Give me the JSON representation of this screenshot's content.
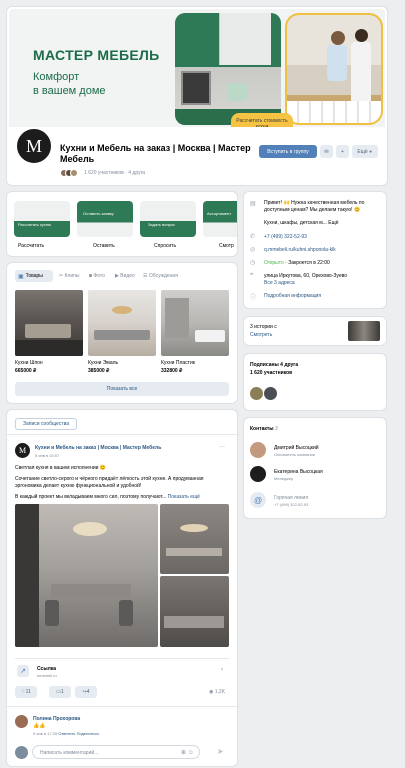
{
  "cover": {
    "brand": "МАСТЕР МЕБЕЛЬ",
    "tagline1": "Комфорт",
    "tagline2": "в вашем доме",
    "cta": "Рассчитать стоимость кухни",
    "brand_color": "#1d6b4a"
  },
  "group": {
    "name": "Кухни и Мебель на заказ | Москва | Мастер",
    "name2": "Мебель",
    "members_line": "1 620 участников · 4 друга",
    "join_button": "Вступить в группу",
    "more_button": "Ещё"
  },
  "services": [
    {
      "thumb": "Рассчитать кухню",
      "label": "Рассчитать"
    },
    {
      "thumb": "Оставить заявку",
      "label": "Оставить"
    },
    {
      "thumb": "Задать вопрос",
      "label": "Спросить"
    },
    {
      "thumb": "Ассортимент",
      "label": "Смотр"
    }
  ],
  "tabs": {
    "goods": "Товары",
    "clips": "Клипы",
    "photo": "Фото",
    "video": "Видео",
    "discussions": "Обсуждения"
  },
  "products": [
    {
      "name": "Кухни Шпон",
      "price": "665000 ₽"
    },
    {
      "name": "Кухни Эмаль",
      "price": "385000 ₽"
    },
    {
      "name": "Кухни Пластик",
      "price": "332800 ₽"
    }
  ],
  "show_all": "Показать все",
  "feed": {
    "tab": "Записи сообщества",
    "author": "Кухни и Мебель на заказ | Москва | Мастер Мебель",
    "time": "5 янв в 15:57",
    "line1": "Светлая кухня в вашем исполнении 😊",
    "line2": "Сочетание светло-серого и чёрного придаёт лёгкость этой кухне. А продуманная",
    "line3": "эргономика делает кухню функциональной и удобной!",
    "line4": "В каждый проект мы вкладываем много сил, поэтому получают...",
    "show_more": "Показать ещё",
    "link_title": "Ссылка",
    "link_url": "mmebeli.ru",
    "likes": "11",
    "comments": "1",
    "shares": "4",
    "views": "1,2K"
  },
  "comment": {
    "author": "Полина Прохорова",
    "text": "👍👍",
    "time": "5 янв в 17:35",
    "reply": "Ответить",
    "share": "Поделиться",
    "placeholder": "Написать комментарий..."
  },
  "info": {
    "welcome1": "Привет! 🙌 Нужна качественная мебель по",
    "welcome2": "доступным ценам? Мы делаем такую! 😊",
    "welcome3": "Кухни, шкафы, детская м... Ещё",
    "phone": "+7 (499) 322-52-93",
    "site": "q.mmebeli.ru/kuhni.shponola-klk",
    "hours_status": "Открыто",
    "hours": "· Закроется в 22:00",
    "address": "улица Иркутова, 60, Орехово-Зуево",
    "all_addresses": "Все 3 адреса",
    "more_info": "Подробная информация"
  },
  "stories": {
    "line1": "3 истории с",
    "line2": "Смотреть"
  },
  "subscribed": {
    "title": "Подписаны 4 друга",
    "count": "1 620 участников"
  },
  "contacts": {
    "title": "Контакты",
    "count": "3",
    "items": [
      {
        "name": "Дмитрий Высоцкий",
        "role": "Основатель компании"
      },
      {
        "name": "Екатерина Высоцкая",
        "role": "Менеджер"
      },
      {
        "name": "Горячая линия",
        "role": "+7 (499) 322-52-93"
      }
    ]
  }
}
